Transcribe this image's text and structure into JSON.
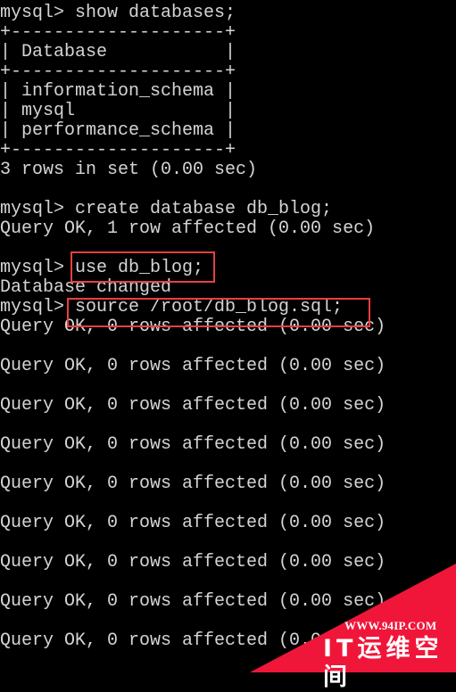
{
  "terminal": {
    "lines": [
      "mysql> show databases;",
      "+--------------------+",
      "| Database           |",
      "+--------------------+",
      "| information_schema |",
      "| mysql              |",
      "| performance_schema |",
      "+--------------------+",
      "3 rows in set (0.00 sec)",
      "",
      "mysql> create database db_blog;",
      "Query OK, 1 row affected (0.00 sec)",
      "",
      "mysql> use db_blog;",
      "Database changed",
      "mysql> source /root/db_blog.sql;",
      "Query OK, 0 rows affected (0.00 sec)",
      "",
      "Query OK, 0 rows affected (0.00 sec)",
      "",
      "Query OK, 0 rows affected (0.00 sec)",
      "",
      "Query OK, 0 rows affected (0.00 sec)",
      "",
      "Query OK, 0 rows affected (0.00 sec)",
      "",
      "Query OK, 0 rows affected (0.00 sec)",
      "",
      "Query OK, 0 rows affected (0.00 sec)",
      "",
      "Query OK, 0 rows affected (0.00 sec)",
      "",
      "Query OK, 0 rows affected (0.00 sec)"
    ],
    "highlighted_commands": [
      "use db_blog;",
      "source /root/db_blog.sql;"
    ],
    "text_color": "#d4d4d4",
    "background": "#000000",
    "highlight_color": "#e8403f"
  },
  "watermark": {
    "url": "WWW.94IP.COM",
    "name": "IT运维空间",
    "color": "#f0163a"
  }
}
